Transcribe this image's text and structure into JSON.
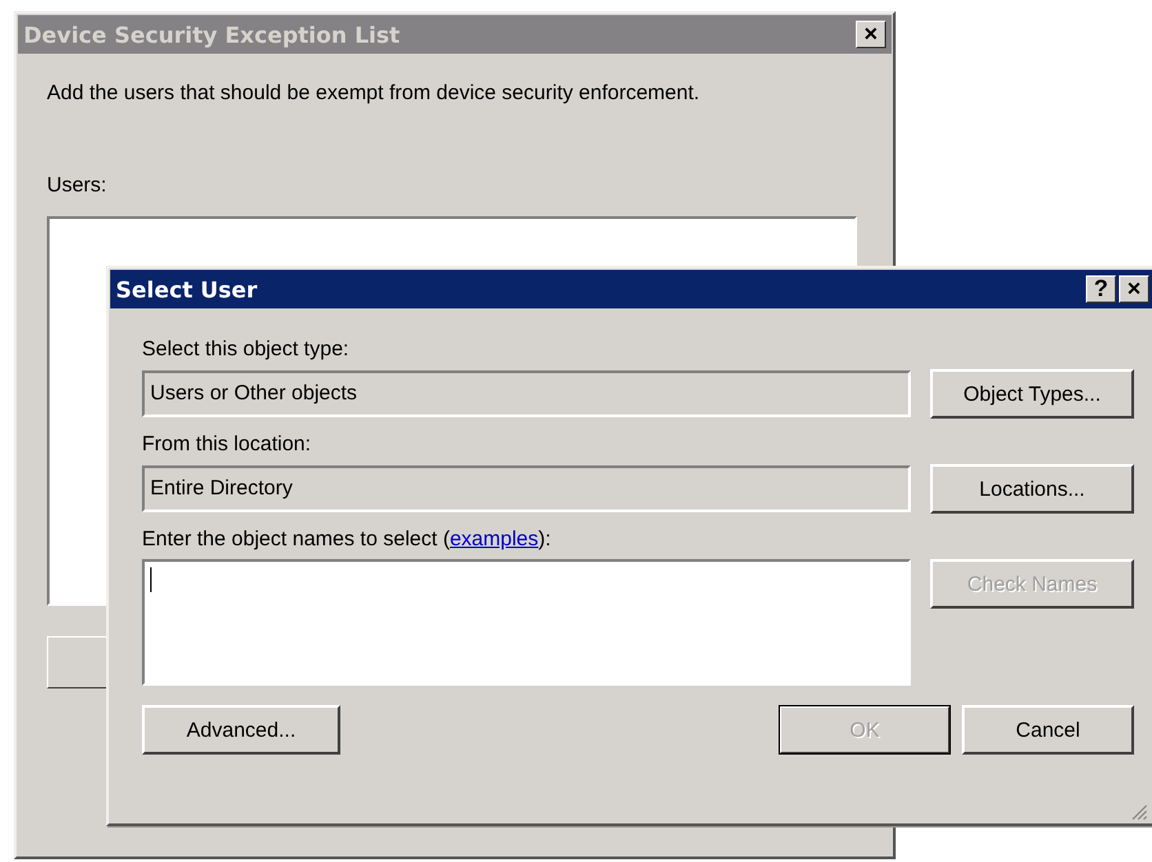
{
  "back_window": {
    "title": "Device Security Exception List",
    "active": false,
    "close": "×",
    "description": "Add the users that should be exempt from device security enforcement.",
    "users_label": "Users:"
  },
  "dialog": {
    "title": "Select User",
    "active": true,
    "help": "?",
    "close": "×",
    "object_type": {
      "label": "Select this object type:",
      "value": "Users or Other objects",
      "button": "Object Types..."
    },
    "location": {
      "label": "From this location:",
      "value": "Entire Directory",
      "button": "Locations..."
    },
    "names": {
      "label_before": "Enter the object names to select (",
      "link": "examples",
      "label_after": "):",
      "check_button": {
        "label": "Check Names",
        "disabled": true
      }
    },
    "buttons": [
      {
        "kind": "advanced",
        "label": "Advanced...",
        "disabled": false,
        "default": false
      },
      {
        "kind": "ok",
        "label": "OK",
        "disabled": true,
        "default": true
      },
      {
        "kind": "cancel",
        "label": "Cancel",
        "disabled": false,
        "default": false
      }
    ]
  }
}
